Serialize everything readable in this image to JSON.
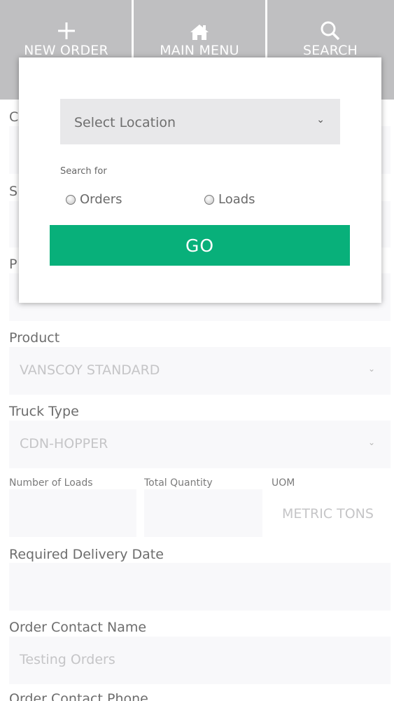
{
  "nav": {
    "new_order": "NEW ORDER",
    "main_menu": "MAIN MENU",
    "search": "SEARCH"
  },
  "form": {
    "cut_labels": [
      "C",
      "S",
      "P"
    ],
    "product_label": "Product",
    "product_value": "VANSCOY STANDARD",
    "truck_type_label": "Truck Type",
    "truck_type_value": "CDN-HOPPER",
    "number_of_loads_label": "Number of Loads",
    "total_quantity_label": "Total Quantity",
    "uom_label": "UOM",
    "uom_value": "METRIC TONS",
    "required_delivery_date_label": "Required Delivery Date",
    "order_contact_name_label": "Order Contact Name",
    "order_contact_name_value": "Testing Orders",
    "order_contact_phone_label": "Order Contact Phone"
  },
  "modal": {
    "location_select": "Select Location",
    "search_for_label": "Search for",
    "option_orders": "Orders",
    "option_loads": "Loads",
    "go_button": "GO"
  },
  "colors": {
    "nav_bg": "#bfbfc1",
    "go_button": "#08b07a",
    "field_bg": "#f8f8fa"
  }
}
